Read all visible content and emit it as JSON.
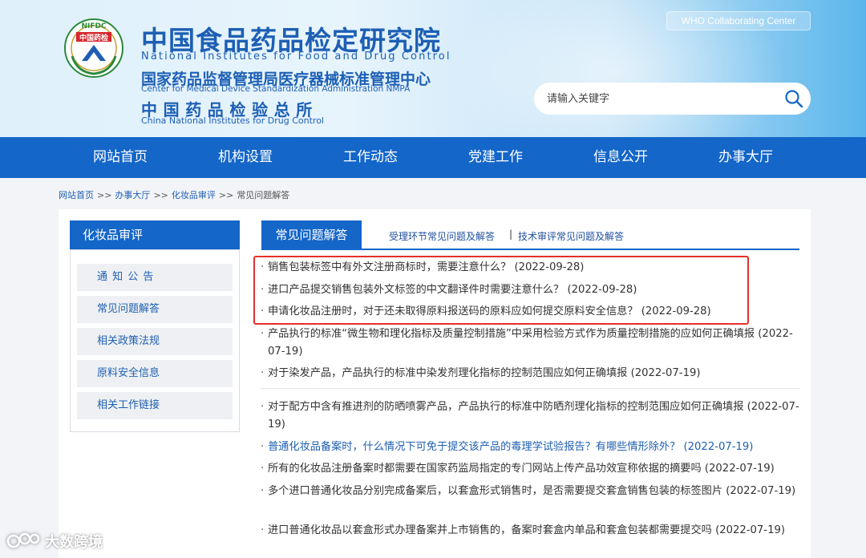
{
  "header": {
    "logo_text": "中国药检",
    "logo_arc": "NIFDC",
    "title_zh": "中国食品药品检定研究院",
    "title_en": "National Institutes for Food and Drug Control",
    "sub1_zh": "国家药品监督管理局医疗器械标准管理中心",
    "sub1_en": "Center for Medical Device Standardization Administration NMPA",
    "sub2_zh": "中国药品检验总所",
    "sub2_en": "China National Institutes for Drug Control",
    "who_badge": "WHO Collaborating Center",
    "search_placeholder": "请输入关键字"
  },
  "nav": [
    "网站首页",
    "机构设置",
    "工作动态",
    "党建工作",
    "信息公开",
    "办事大厅"
  ],
  "breadcrumb": [
    "网站首页",
    "办事大厅",
    "化妆品审评",
    "常见问题解答"
  ],
  "breadcrumb_sep": ">>",
  "sidebar": {
    "title": "化妆品审评",
    "items": [
      "通 知 公 告",
      "常见问题解答",
      "相关政策法规",
      "原料安全信息",
      "相关工作链接"
    ]
  },
  "tabs": {
    "active": "常见问题解答",
    "links": [
      "受理环节常见问题及解答",
      "技术审评常见问题及解答"
    ],
    "divider": "|"
  },
  "bullet": "·",
  "faq": [
    {
      "text": "销售包装标签中有外文注册商标时，需要注意什么？ (2022-09-28)"
    },
    {
      "text": "进口产品提交销售包装外文标签的中文翻译件时需要注意什么？ (2022-09-28)"
    },
    {
      "text": "申请化妆品注册时，对于还未取得原料报送码的原料应如何提交原料安全信息？ (2022-09-28)"
    },
    {
      "text": "产品执行的标准“微生物和理化指标及质量控制措施”中采用检验方式作为质量控制措施的应如何正确填报 (2022-07-19)"
    },
    {
      "text": "对于染发产品，产品执行的标准中染发剂理化指标的控制范围应如何正确填报 (2022-07-19)"
    },
    {
      "text": "对于配方中含有推进剂的防晒喷雾产品，产品执行的标准中防晒剂理化指标的控制范围应如何正确填报 (2022-07-19)"
    },
    {
      "text": "普通化妆品备案时，什么情况下可免于提交该产品的毒理学试验报告？有哪些情形除外？ (2022-07-19)"
    },
    {
      "text": "所有的化妆品注册备案时都需要在国家药监局指定的专门网站上传产品功效宣称依据的摘要吗 (2022-07-19)"
    },
    {
      "text": "多个进口普通化妆品分别完成备案后，以套盒形式销售时，是否需要提交套盒销售包装的标签图片 (2022-07-19)"
    },
    {
      "text": "进口普通化妆品以套盒形式办理备案并上市销售的，备案时套盒内单品和套盒包装都需要提交吗 (2022-07-19)"
    }
  ],
  "watermark": "大数跨境",
  "colors": {
    "nav_blue": "#1466c8",
    "link_blue": "#1f5fb0",
    "highlight_red": "#e6302b"
  }
}
